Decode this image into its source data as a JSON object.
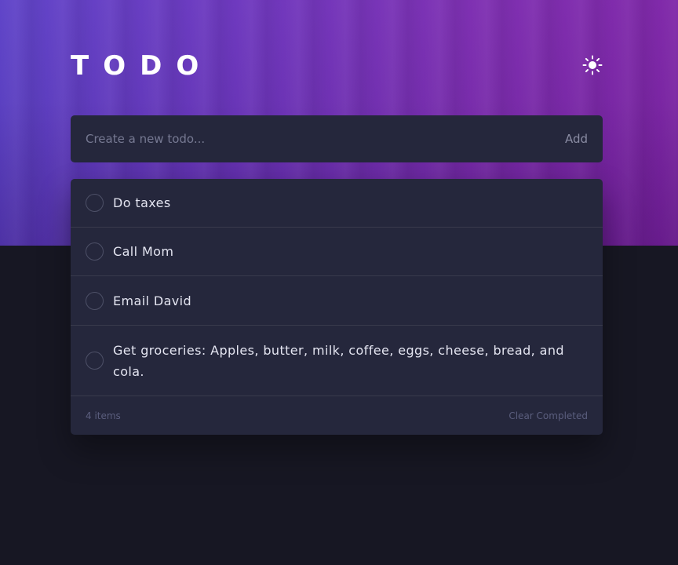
{
  "app": {
    "title": "TODO",
    "theme_icon": "sun-icon"
  },
  "new_todo": {
    "placeholder": "Create a new todo...",
    "value": "",
    "add_label": "Add"
  },
  "todos": [
    {
      "text": "Do taxes",
      "completed": false
    },
    {
      "text": "Call Mom",
      "completed": false
    },
    {
      "text": "Email David",
      "completed": false
    },
    {
      "text": "Get groceries: Apples, butter, milk, coffee, eggs, cheese, bread, and cola.",
      "completed": false
    }
  ],
  "footer": {
    "items_left": "4 items",
    "clear_label": "Clear Completed"
  },
  "colors": {
    "panel": "#25273c",
    "background": "#171723",
    "hero_gradient_start": "#5b3fc7",
    "hero_gradient_end": "#7c22a6"
  }
}
